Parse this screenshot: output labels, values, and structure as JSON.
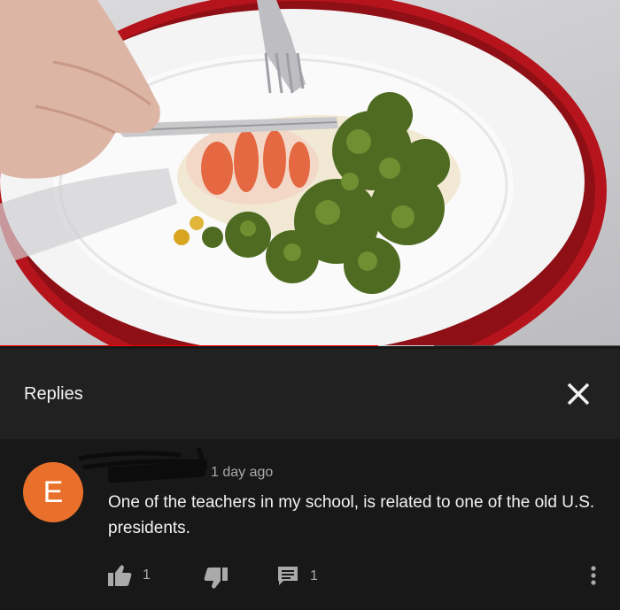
{
  "video": {
    "description_icon": "video-frame",
    "progress_played_fraction": 0.61,
    "progress_buffered_fraction": 0.7
  },
  "replies_panel": {
    "title": "Replies",
    "close_icon": "close-icon"
  },
  "comment": {
    "avatar_letter": "E",
    "avatar_color": "#e8702a",
    "author_redacted": true,
    "timestamp": "1 day ago",
    "text": "One of the teachers in my school, is related to one of the old U.S. presidents.",
    "like_count": "1",
    "reply_count": "1",
    "icons": {
      "like": "thumbs-up-icon",
      "dislike": "thumbs-down-icon",
      "reply": "comment-icon",
      "more": "more-vertical-icon"
    }
  }
}
